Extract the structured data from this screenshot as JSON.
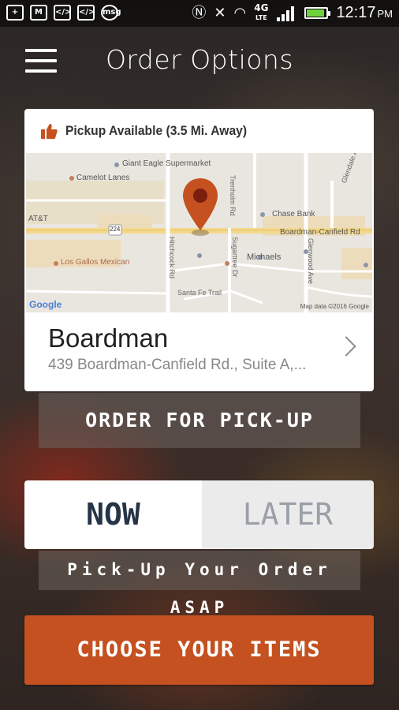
{
  "status_bar": {
    "notif_icons": [
      "+",
      "M",
      "</>",
      "</>",
      "msg"
    ],
    "network": "4G",
    "network_sub": "LTE",
    "battery_level": 0.9,
    "time": "12:17",
    "ampm": "PM"
  },
  "header": {
    "title": "Order Options"
  },
  "location_card": {
    "pickup_text": "Pickup Available (3.5 Mi. Away)",
    "store_name": "Boardman",
    "store_address": "439 Boardman-Canfield Rd., Suite A,...",
    "map_labels": {
      "giant_eagle": "Giant Eagle Supermarket",
      "camelot": "Camelot Lanes",
      "att": "AT&T",
      "chase": "Chase Bank",
      "canfield": "Boardman-Canfield Rd",
      "los_gallos": "Los Gallos Mexican",
      "michaels": "Michaels",
      "santa_fe": "Santa Fe Trail",
      "trenholm": "Trenholm Rd",
      "glendale": "Glendale Ave",
      "hitchcock": "Hitchcock Rd",
      "sugartree": "Sugartree Dr",
      "glenwood": "Glenwood Ave",
      "route_shield": "224",
      "google": "Google",
      "map_data": "Map data ©2016 Google"
    }
  },
  "order_button": {
    "label": "ORDER FOR PICK-UP"
  },
  "time_toggle": {
    "now": "NOW",
    "later": "LATER"
  },
  "asap_text": "Pick-Up Your Order ASAP",
  "choose_button": {
    "label": "CHOOSE YOUR ITEMS"
  },
  "colors": {
    "accent": "#c4511f",
    "now_text": "#253447",
    "battery": "#6ed33a"
  }
}
